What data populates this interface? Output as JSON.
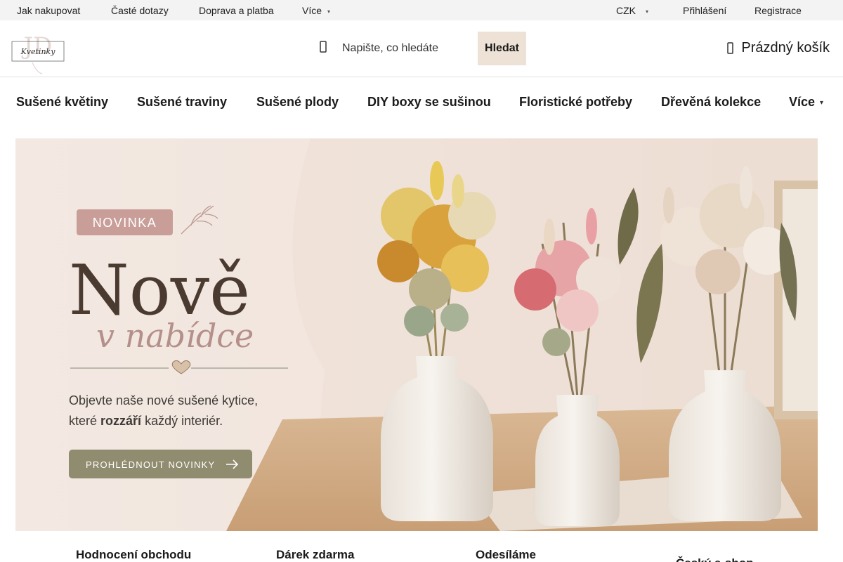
{
  "topbar": {
    "links": [
      "Jak nakupovat",
      "Časté dotazy",
      "Doprava a platba",
      "Více"
    ],
    "currency": "CZK",
    "login": "Přihlášení",
    "register": "Registrace"
  },
  "header": {
    "logo_text": "Kvetinky",
    "search": {
      "placeholder": "Napište, co hledáte",
      "button": "Hledat"
    },
    "cart": "Prázdný košík"
  },
  "categories": [
    "Sušené květiny",
    "Sušené traviny",
    "Sušené plody",
    "DIY boxy se sušinou",
    "Floristické potřeby",
    "Dřevěná kolekce",
    "Více"
  ],
  "hero": {
    "badge": "NOVINKA",
    "title": "Nově",
    "subtitle": "v nabídce",
    "text_line1": "Objevte naše nové sušené kytice,",
    "text_line2_pre": "které ",
    "text_line2_bold": "rozzáří",
    "text_line2_post": " každý interiér.",
    "cta": "PROHLÉDNOUT NOVINKY"
  },
  "benefits": [
    "Hodnocení obchodu",
    "Dárek zdarma",
    "Odesíláme",
    "Český e-shop"
  ],
  "colors": {
    "accent_beige": "#ede2d5",
    "badge_rose": "#c99e98",
    "cta_olive": "#8f8c70",
    "title_brown": "#4a3a30",
    "script_rose": "#b58f8a"
  },
  "icons": [
    "search-icon",
    "cart-icon",
    "chevron-down-icon",
    "heart-icon",
    "arrow-right-icon",
    "leaf-icon"
  ]
}
